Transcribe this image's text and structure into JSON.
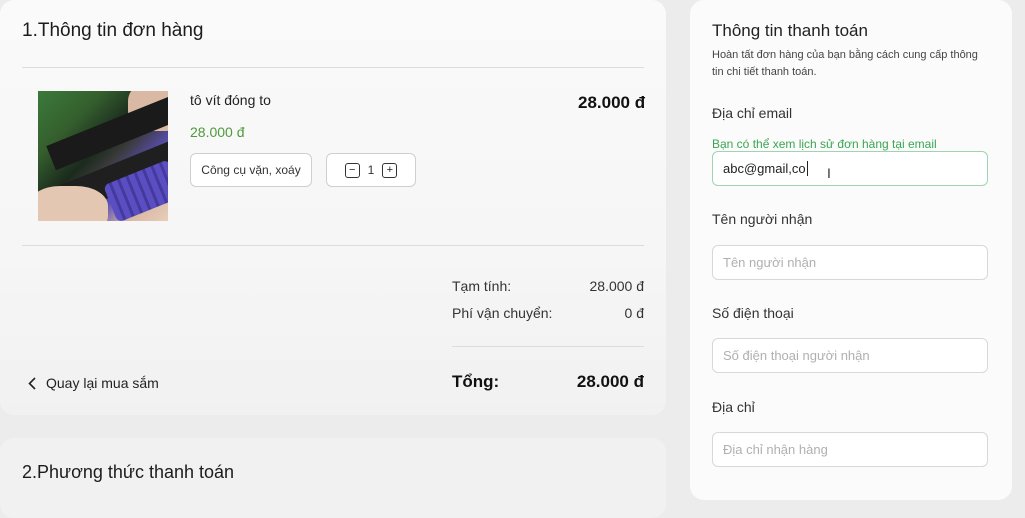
{
  "order": {
    "title": "1.Thông tin đơn hàng",
    "item": {
      "name": "tô vít đóng to",
      "price": "28.000 đ",
      "line_total": "28.000 đ",
      "category": "Công cụ vặn, xoáy",
      "quantity": "1",
      "minus": "−",
      "plus": "+"
    },
    "summary": {
      "subtotal_label": "Tạm tính:",
      "subtotal_value": "28.000 đ",
      "shipping_label": "Phí vận chuyển:",
      "shipping_value": "0 đ",
      "total_label": "Tổng:",
      "total_value": "28.000 đ"
    },
    "back_label": "Quay lại mua sắm"
  },
  "payment_method": {
    "title": "2.Phương thức thanh toán"
  },
  "payment_info": {
    "title": "Thông tin thanh toán",
    "description": "Hoàn tất đơn hàng của bạn bằng cách cung cấp thông tin chi tiết thanh toán.",
    "email": {
      "label": "Địa chỉ email",
      "hint": "Bạn có thể xem lịch sử đơn hàng tại email",
      "value": "abc@gmail,co"
    },
    "recipient": {
      "label": "Tên người nhận",
      "placeholder": "Tên người nhận"
    },
    "phone": {
      "label": "Số điện thoại",
      "placeholder": "Số điện thoại người nhận"
    },
    "address": {
      "label": "Địa chỉ",
      "placeholder": "Địa chỉ nhận hàng"
    }
  },
  "colors": {
    "accent_green": "#4c9a3b",
    "hint_green": "#3aa652",
    "active_border": "#9fd4b0"
  }
}
